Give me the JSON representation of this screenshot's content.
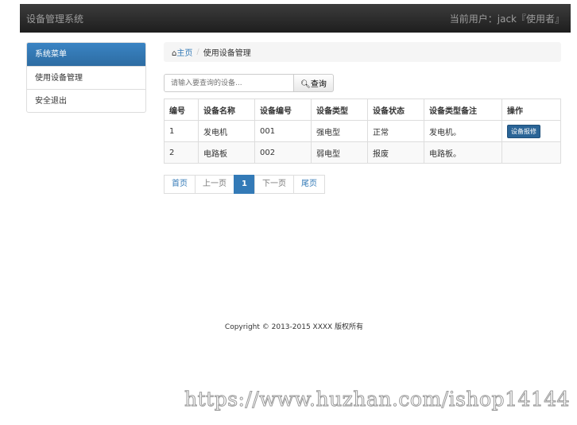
{
  "navbar": {
    "title": "设备管理系统",
    "user": "当前用户：jack『使用者』"
  },
  "sidebar": {
    "header": "系统菜单",
    "items": [
      {
        "label": "使用设备管理"
      },
      {
        "label": "安全退出"
      }
    ]
  },
  "breadcrumb": {
    "home": "主页",
    "current": "使用设备管理"
  },
  "search": {
    "placeholder": "请输入要查询的设备...",
    "button": "查询"
  },
  "table": {
    "headers": [
      "编号",
      "设备名称",
      "设备编号",
      "设备类型",
      "设备状态",
      "设备类型备注",
      "操作"
    ],
    "rows": [
      [
        "1",
        "发电机",
        "001",
        "强电型",
        "正常",
        "发电机。"
      ],
      [
        "2",
        "电路板",
        "002",
        "弱电型",
        "报废",
        "电路板。"
      ]
    ],
    "action_label": "设备报修"
  },
  "pagination": {
    "first": "首页",
    "prev": "上一页",
    "current": "1",
    "next": "下一页",
    "last": "尾页"
  },
  "footer": "Copyright © 2013-2015 XXXX 版权所有",
  "watermark": "https://www.huzhan.com/ishop14144"
}
